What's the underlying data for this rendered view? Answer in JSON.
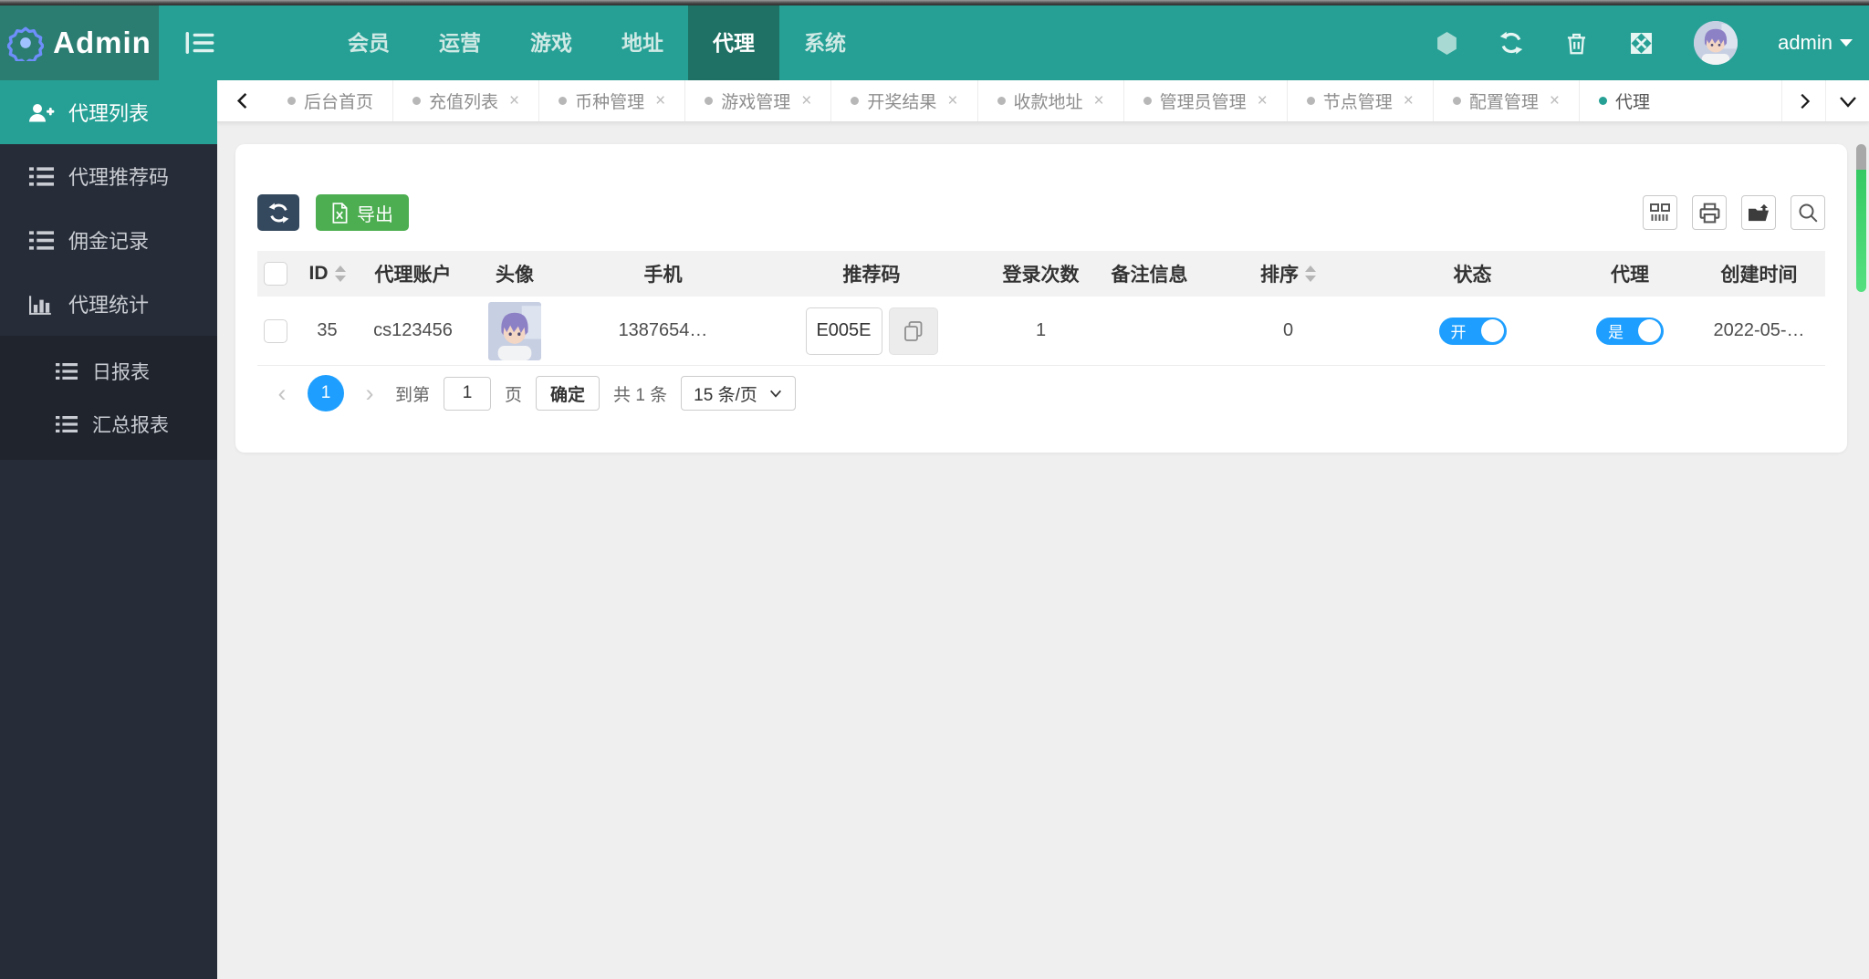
{
  "header": {
    "logo_title": "Admin",
    "nav_items": [
      {
        "label": "会员"
      },
      {
        "label": "运营"
      },
      {
        "label": "游戏"
      },
      {
        "label": "地址"
      },
      {
        "label": "代理"
      },
      {
        "label": "系统"
      }
    ],
    "username": "admin"
  },
  "tabbar": {
    "tabs": [
      {
        "label": "后台首页"
      },
      {
        "label": "充值列表"
      },
      {
        "label": "币种管理"
      },
      {
        "label": "游戏管理"
      },
      {
        "label": "开奖结果"
      },
      {
        "label": "收款地址"
      },
      {
        "label": "管理员管理"
      },
      {
        "label": "节点管理"
      },
      {
        "label": "配置管理"
      },
      {
        "label": "代理"
      }
    ]
  },
  "sidebar": {
    "items": [
      {
        "label": "代理列表"
      },
      {
        "label": "代理推荐码"
      },
      {
        "label": "佣金记录"
      },
      {
        "label": "代理统计"
      }
    ],
    "subitems": [
      {
        "label": "日报表"
      },
      {
        "label": "汇总报表"
      }
    ]
  },
  "toolbar": {
    "export_label": "导出"
  },
  "table": {
    "headers": [
      "ID",
      "代理账户",
      "头像",
      "手机",
      "推荐码",
      "登录次数",
      "备注信息",
      "排序",
      "状态",
      "代理",
      "创建时间"
    ],
    "row": {
      "id": "35",
      "account": "cs123456",
      "phone": "1387654…",
      "code": "E005E",
      "login_count": "1",
      "remark": "",
      "sort": "0",
      "status_label": "开",
      "agent_label": "是",
      "created_at": "2022-05-…"
    }
  },
  "pagination": {
    "prev": "‹",
    "current_page": "1",
    "next": "›",
    "goto_label": "到第",
    "page_input": "1",
    "page_unit": "页",
    "confirm_label": "确定",
    "total_label": "共 1 条",
    "page_size_label": "15 条/页"
  },
  "icons": {
    "close": "×"
  },
  "colors": {
    "primary_teal": "#26a095",
    "nav_active_teal": "#1e7164",
    "logo_bg_teal": "#2b7c71",
    "sidebar_dark": "#272d38",
    "accent_blue": "#1e9fff",
    "export_green": "#4cae50",
    "refresh_dark": "#34495e",
    "scrollbar_green": "#47d16e"
  }
}
